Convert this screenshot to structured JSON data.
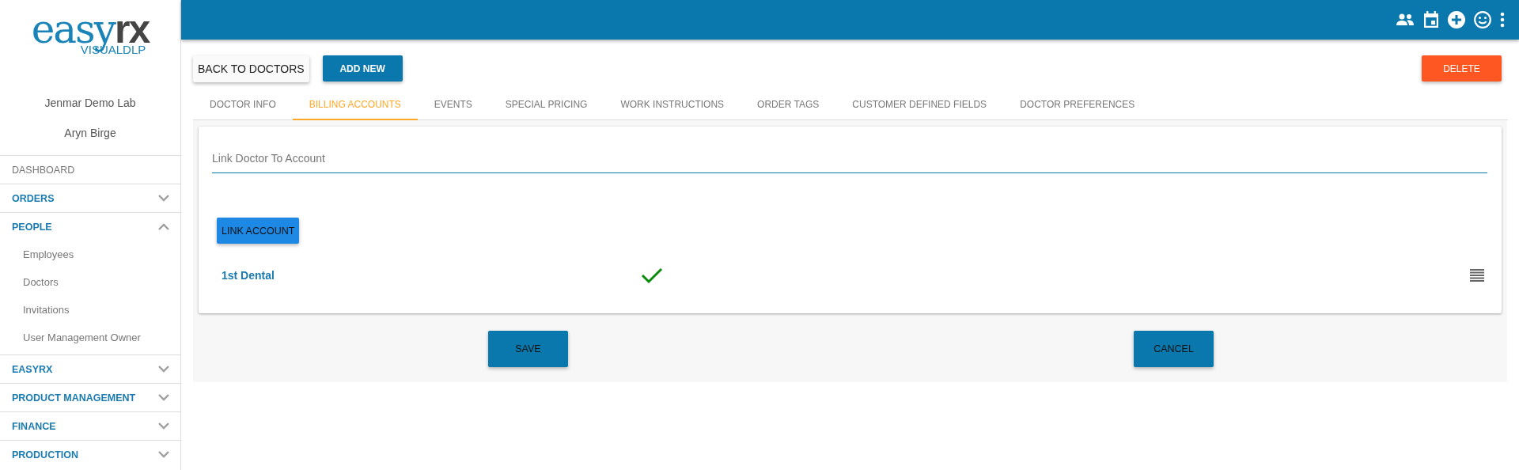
{
  "logo": {
    "brand": "easy",
    "accent": "rx",
    "sub": "VISUALDLP"
  },
  "sidebar": {
    "lab": "Jenmar Demo Lab",
    "user": "Aryn Birge",
    "items": [
      {
        "label": "DASHBOARD",
        "kind": "link"
      },
      {
        "label": "ORDERS",
        "kind": "group",
        "expanded": false
      },
      {
        "label": "PEOPLE",
        "kind": "group",
        "expanded": true,
        "children": [
          {
            "label": "Employees"
          },
          {
            "label": "Doctors"
          },
          {
            "label": "Invitations"
          },
          {
            "label": "User Management Owner"
          }
        ]
      },
      {
        "label": "EASYRX",
        "kind": "group",
        "expanded": false
      },
      {
        "label": "PRODUCT MANAGEMENT",
        "kind": "group",
        "expanded": false
      },
      {
        "label": "FINANCE",
        "kind": "group",
        "expanded": false
      },
      {
        "label": "PRODUCTION",
        "kind": "group",
        "expanded": false
      }
    ]
  },
  "actions": {
    "back": "BACK TO DOCTORS",
    "add": "ADD NEW",
    "delete": "DELETE"
  },
  "tabs": [
    {
      "label": "DOCTOR INFO",
      "selected": false
    },
    {
      "label": "BILLING ACCOUNTS",
      "selected": true
    },
    {
      "label": "EVENTS",
      "selected": false
    },
    {
      "label": "SPECIAL PRICING",
      "selected": false
    },
    {
      "label": "WORK INSTRUCTIONS",
      "selected": false
    },
    {
      "label": "ORDER TAGS",
      "selected": false
    },
    {
      "label": "CUSTOMER DEFINED FIELDS",
      "selected": false
    },
    {
      "label": "DOCTOR PREFERENCES",
      "selected": false
    }
  ],
  "link_field": {
    "placeholder": "Link Doctor To Account"
  },
  "link_button": "LINK ACCOUNT",
  "accounts": [
    {
      "name": "1st Dental",
      "linked": true
    }
  ],
  "footer_buttons": [
    "SAVE",
    "CANCEL"
  ]
}
